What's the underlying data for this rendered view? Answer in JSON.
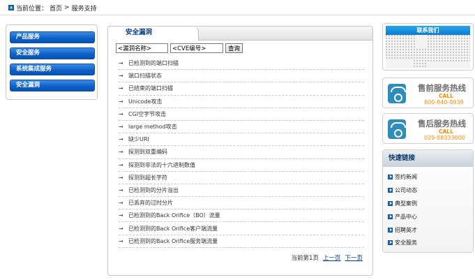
{
  "breadcrumb": {
    "prefix": "当前位置：",
    "home": "首页",
    "sep": " > ",
    "current": "服务支持"
  },
  "left_menu": [
    "产品服务",
    "安全服务",
    "系统集成服务",
    "安全漏洞"
  ],
  "main": {
    "tab_title": "安全漏洞",
    "search": {
      "name_value": "<漏洞名称>",
      "cve_value": "<CVE编号>",
      "button": "查询"
    },
    "items": [
      "已检测到的端口扫描",
      "端口扫描状态",
      "已结束的端口扫描",
      "Unicode攻击",
      "CGI空字节攻击",
      "large method攻击",
      "缺少URI",
      "探测到双重编码",
      "探测到非法的十六进制数值",
      "探测到超长字符",
      "已检测到的分片溢出",
      "已丢弃的过时分片",
      "已检测到的Back Orifice（BO）流量",
      "已检测到的Back Orifice客户端流量",
      "已检测到的Back Orifice服务端流量"
    ],
    "pager": {
      "info": "当前第1页",
      "prev": "上一页",
      "next": "下一页"
    }
  },
  "right": {
    "contact_title": "联系我们",
    "presale": {
      "title": "售前服务热线",
      "call": "CALL",
      "number": "800-840-9939"
    },
    "aftersale": {
      "title": "售后服务热线",
      "call": "CALL",
      "number": "029-88333000"
    },
    "quick": {
      "title": "快速链接",
      "links": [
        "签约新闻",
        "公司动态",
        "典型案例",
        "产品中心",
        "招聘英才",
        "安全服务"
      ]
    }
  },
  "colors": {
    "menu_blue": "#0a5fc7",
    "link_blue": "#0b3f84",
    "hotline_orange": "#ff8a00"
  }
}
